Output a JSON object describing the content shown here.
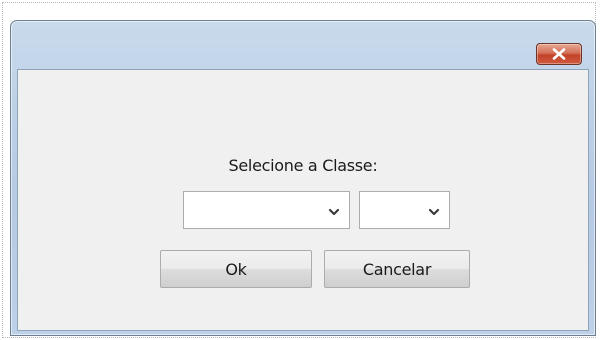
{
  "dialog": {
    "title": "",
    "close_icon": "close-x-icon",
    "prompt": "Selecione a Classe:",
    "combo_primary": {
      "value": ""
    },
    "combo_secondary": {
      "value": ""
    },
    "ok_label": "Ok",
    "cancel_label": "Cancelar"
  },
  "colors": {
    "close_button": "#c9543a",
    "client_background": "#f0f0f0",
    "frame": "#bcd0e6"
  }
}
